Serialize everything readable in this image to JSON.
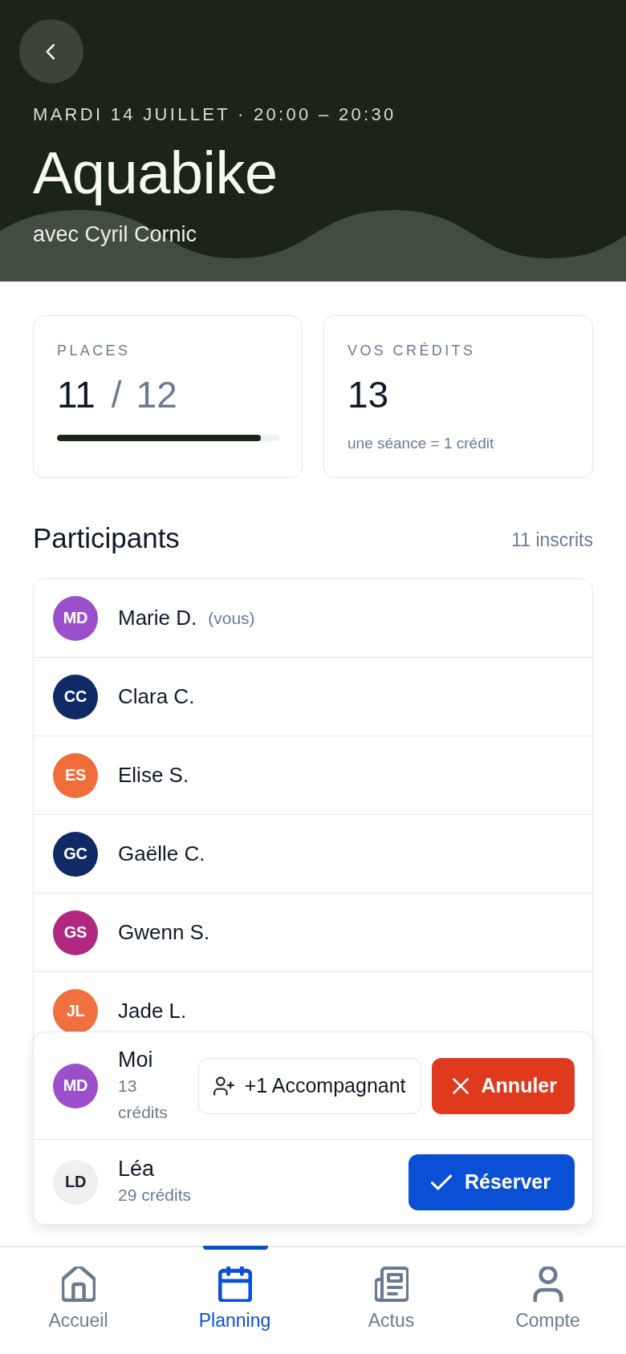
{
  "header": {
    "datetime": "MARDI 14 JUILLET · 20:00 – 20:30",
    "title": "Aquabike",
    "instructor": "avec Cyril Cornic"
  },
  "stats": [
    {
      "kind": "places",
      "label": "PLACES",
      "value": "11",
      "separator": "/",
      "total": "12",
      "level": 0.917
    },
    {
      "kind": "credits",
      "label": "VOS CRÉDITS",
      "value": "13",
      "note": "une séance = 1 crédit"
    }
  ],
  "participants": {
    "title": "Participants",
    "count": "11 inscrits",
    "rows": [
      {
        "initials": "MD",
        "name": "Marie D.",
        "tag": "(vous)",
        "color": "#9b4fcb"
      },
      {
        "initials": "CC",
        "name": "Clara C.",
        "color": "#102a66"
      },
      {
        "initials": "ES",
        "name": "Elise S.",
        "color": "#f06d3a"
      },
      {
        "initials": "GC",
        "name": "Gaëlle C.",
        "color": "#102a66"
      },
      {
        "initials": "GS",
        "name": "Gwenn S.",
        "color": "#b0287f"
      },
      {
        "initials": "JL",
        "name": "Jade L.",
        "color": "#f07040"
      }
    ]
  },
  "booking": {
    "rows": [
      {
        "initials": "MD",
        "name": "Moi",
        "credits": "13 crédits",
        "color": "#9b4fcb",
        "actions": [
          {
            "kind": "companion",
            "label": "+1 Accompagnant"
          },
          {
            "kind": "cancel",
            "label": "Annuler"
          }
        ]
      },
      {
        "initials": "LD",
        "name": "Léa",
        "credits": "29 crédits",
        "color": "#efefef",
        "actions": [
          {
            "kind": "reserve",
            "label": "Réserver"
          }
        ]
      }
    ]
  },
  "tab_bar": [
    {
      "kind": "home",
      "label": "Accueil",
      "selected": false
    },
    {
      "kind": "calendar",
      "label": "Planning",
      "selected": true
    },
    {
      "kind": "news",
      "label": "Actus",
      "selected": false
    },
    {
      "kind": "account",
      "label": "Compte",
      "selected": false
    }
  ]
}
